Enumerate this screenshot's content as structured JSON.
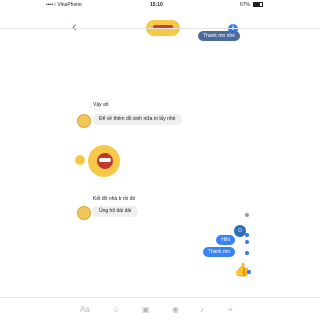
{
  "status_bar": {
    "carrier": "••••○ VinaPhone",
    "time": "15:10",
    "battery": "67%"
  },
  "header": {
    "back_label": "‹",
    "info_label": "i"
  },
  "messages": {
    "thank_top": "Thank mn nhé",
    "vay_ah": "Vậy ah",
    "de_ve_them": "Để về thêm đồ xinh nữa m lấy nhé",
    "ket_do": "Kết đồ nhà b rồi đó",
    "ung_ho": "Ủng hộ dài dài",
    "hihi": "Hihi",
    "thank_bottom": "Thank mn"
  },
  "composer": {
    "tools": [
      "Aa",
      "☺",
      "▣",
      "◉",
      "♪",
      "⌖"
    ]
  },
  "colors": {
    "accent": "#2e7cf6",
    "outgoing": "#3b82f5",
    "incoming_bg": "#efefef"
  }
}
